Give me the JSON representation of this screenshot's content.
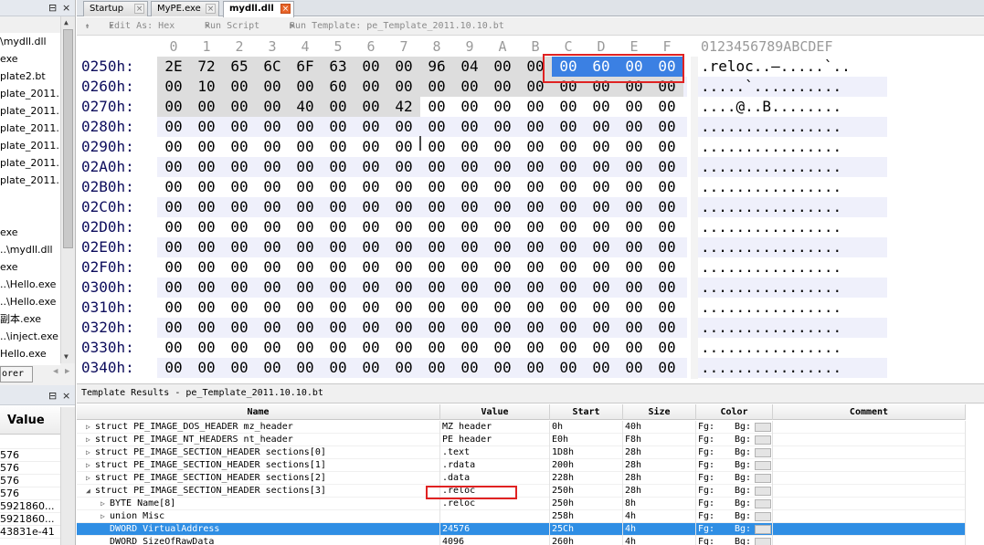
{
  "left_panel": {
    "pin_icons": [
      "⊟",
      "×"
    ],
    "items": [
      "\\mydll.dll",
      "exe",
      "plate2.bt",
      "plate_2011.",
      "plate_2011.",
      "plate_2011.",
      "plate_2011.",
      "plate_2011.",
      "plate_2011.",
      "",
      "",
      "exe",
      "..\\mydll.dll",
      "exe",
      "..\\Hello.exe",
      "..\\Hello.exe",
      "副本.exe",
      "..\\inject.exe",
      "Hello.exe"
    ],
    "explorer_tab": "orer"
  },
  "inspector_panel": {
    "value_header": "Value",
    "values": [
      "",
      "576",
      "576",
      "576",
      "576",
      "5921860...",
      "5921860...",
      "43831e-41"
    ]
  },
  "tabs": [
    {
      "label": "Startup"
    },
    {
      "label": "MyPE.exe"
    },
    {
      "label": "mydll.dll",
      "active": true
    }
  ],
  "toolbar": {
    "edit_as": "Edit As: Hex",
    "run_script": "Run Script",
    "run_template": "Run Template: pe_Template_2011.10.10.bt"
  },
  "hex": {
    "column_headers": [
      "0",
      "1",
      "2",
      "3",
      "4",
      "5",
      "6",
      "7",
      "8",
      "9",
      "A",
      "B",
      "C",
      "D",
      "E",
      "F"
    ],
    "ascii_header": "0123456789ABCDEF",
    "rows": [
      {
        "addr": "0250h:",
        "bytes": [
          "2E",
          "72",
          "65",
          "6C",
          "6F",
          "63",
          "00",
          "00",
          "96",
          "04",
          "00",
          "00",
          "00",
          "60",
          "00",
          "00"
        ],
        "ascii": ".reloc..–.....`.."
      },
      {
        "addr": "0260h:",
        "bytes": [
          "00",
          "10",
          "00",
          "00",
          "00",
          "60",
          "00",
          "00",
          "00",
          "00",
          "00",
          "00",
          "00",
          "00",
          "00",
          "00"
        ],
        "ascii": ".....`.........."
      },
      {
        "addr": "0270h:",
        "bytes": [
          "00",
          "00",
          "00",
          "00",
          "40",
          "00",
          "00",
          "42",
          "00",
          "00",
          "00",
          "00",
          "00",
          "00",
          "00",
          "00"
        ],
        "ascii": "....@..B........"
      },
      {
        "addr": "0280h:",
        "bytes": [
          "00",
          "00",
          "00",
          "00",
          "00",
          "00",
          "00",
          "00",
          "00",
          "00",
          "00",
          "00",
          "00",
          "00",
          "00",
          "00"
        ],
        "ascii": "................"
      },
      {
        "addr": "0290h:",
        "bytes": [
          "00",
          "00",
          "00",
          "00",
          "00",
          "00",
          "00",
          "00",
          "00",
          "00",
          "00",
          "00",
          "00",
          "00",
          "00",
          "00"
        ],
        "ascii": "................"
      },
      {
        "addr": "02A0h:",
        "bytes": [
          "00",
          "00",
          "00",
          "00",
          "00",
          "00",
          "00",
          "00",
          "00",
          "00",
          "00",
          "00",
          "00",
          "00",
          "00",
          "00"
        ],
        "ascii": "................"
      },
      {
        "addr": "02B0h:",
        "bytes": [
          "00",
          "00",
          "00",
          "00",
          "00",
          "00",
          "00",
          "00",
          "00",
          "00",
          "00",
          "00",
          "00",
          "00",
          "00",
          "00"
        ],
        "ascii": "................"
      },
      {
        "addr": "02C0h:",
        "bytes": [
          "00",
          "00",
          "00",
          "00",
          "00",
          "00",
          "00",
          "00",
          "00",
          "00",
          "00",
          "00",
          "00",
          "00",
          "00",
          "00"
        ],
        "ascii": "................"
      },
      {
        "addr": "02D0h:",
        "bytes": [
          "00",
          "00",
          "00",
          "00",
          "00",
          "00",
          "00",
          "00",
          "00",
          "00",
          "00",
          "00",
          "00",
          "00",
          "00",
          "00"
        ],
        "ascii": "................"
      },
      {
        "addr": "02E0h:",
        "bytes": [
          "00",
          "00",
          "00",
          "00",
          "00",
          "00",
          "00",
          "00",
          "00",
          "00",
          "00",
          "00",
          "00",
          "00",
          "00",
          "00"
        ],
        "ascii": "................"
      },
      {
        "addr": "02F0h:",
        "bytes": [
          "00",
          "00",
          "00",
          "00",
          "00",
          "00",
          "00",
          "00",
          "00",
          "00",
          "00",
          "00",
          "00",
          "00",
          "00",
          "00"
        ],
        "ascii": "................"
      },
      {
        "addr": "0300h:",
        "bytes": [
          "00",
          "00",
          "00",
          "00",
          "00",
          "00",
          "00",
          "00",
          "00",
          "00",
          "00",
          "00",
          "00",
          "00",
          "00",
          "00"
        ],
        "ascii": "................"
      },
      {
        "addr": "0310h:",
        "bytes": [
          "00",
          "00",
          "00",
          "00",
          "00",
          "00",
          "00",
          "00",
          "00",
          "00",
          "00",
          "00",
          "00",
          "00",
          "00",
          "00"
        ],
        "ascii": "................"
      },
      {
        "addr": "0320h:",
        "bytes": [
          "00",
          "00",
          "00",
          "00",
          "00",
          "00",
          "00",
          "00",
          "00",
          "00",
          "00",
          "00",
          "00",
          "00",
          "00",
          "00"
        ],
        "ascii": "................"
      },
      {
        "addr": "0330h:",
        "bytes": [
          "00",
          "00",
          "00",
          "00",
          "00",
          "00",
          "00",
          "00",
          "00",
          "00",
          "00",
          "00",
          "00",
          "00",
          "00",
          "00"
        ],
        "ascii": "................"
      },
      {
        "addr": "0340h:",
        "bytes": [
          "00",
          "00",
          "00",
          "00",
          "00",
          "00",
          "00",
          "00",
          "00",
          "00",
          "00",
          "00",
          "00",
          "00",
          "00",
          "00"
        ],
        "ascii": "................"
      }
    ]
  },
  "template_results": {
    "title": "Template Results - pe_Template_2011.10.10.bt",
    "columns": [
      "Name",
      "Value",
      "Start",
      "Size",
      "Color",
      "Comment"
    ],
    "rows": [
      {
        "expander": "▷",
        "name": "struct PE_IMAGE_DOS_HEADER mz_header",
        "value": "MZ header",
        "start": "0h",
        "size": "40h",
        "fg": "Fg:",
        "bg": "Bg:"
      },
      {
        "expander": "▷",
        "name": "struct PE_IMAGE_NT_HEADERS nt_header",
        "value": "PE header",
        "start": "E0h",
        "size": "F8h",
        "fg": "Fg:",
        "bg": "Bg:"
      },
      {
        "expander": "▷",
        "name": "struct PE_IMAGE_SECTION_HEADER sections[0]",
        "value": ".text",
        "start": "1D8h",
        "size": "28h",
        "fg": "Fg:",
        "bg": "Bg:"
      },
      {
        "expander": "▷",
        "name": "struct PE_IMAGE_SECTION_HEADER sections[1]",
        "value": ".rdata",
        "start": "200h",
        "size": "28h",
        "fg": "Fg:",
        "bg": "Bg:"
      },
      {
        "expander": "▷",
        "name": "struct PE_IMAGE_SECTION_HEADER sections[2]",
        "value": ".data",
        "start": "228h",
        "size": "28h",
        "fg": "Fg:",
        "bg": "Bg:"
      },
      {
        "expander": "◢",
        "name": "struct PE_IMAGE_SECTION_HEADER sections[3]",
        "value": ".reloc",
        "start": "250h",
        "size": "28h",
        "fg": "Fg:",
        "bg": "Bg:"
      },
      {
        "expander": "▷",
        "name": "BYTE Name[8]",
        "value": ".reloc",
        "start": "250h",
        "size": "8h",
        "fg": "Fg:",
        "bg": "Bg:",
        "indent": 1
      },
      {
        "expander": "▷",
        "name": "union Misc",
        "value": "",
        "start": "258h",
        "size": "4h",
        "fg": "Fg:",
        "bg": "Bg:",
        "indent": 1
      },
      {
        "expander": "",
        "name": "DWORD VirtualAddress",
        "value": "24576",
        "start": "25Ch",
        "size": "4h",
        "fg": "Fg:",
        "bg": "Bg:",
        "indent": 1,
        "selected": true
      },
      {
        "expander": "",
        "name": "DWORD SizeOfRawData",
        "value": "4096",
        "start": "260h",
        "size": "4h",
        "fg": "Fg:",
        "bg": "Bg:",
        "indent": 1
      }
    ]
  },
  "colors": {
    "selection": "#3b80e3",
    "row_selected": "#2f8ee4",
    "highlight_box": "#e02222",
    "alt_row": "#eff0fb",
    "address": "#0c0c5c"
  }
}
